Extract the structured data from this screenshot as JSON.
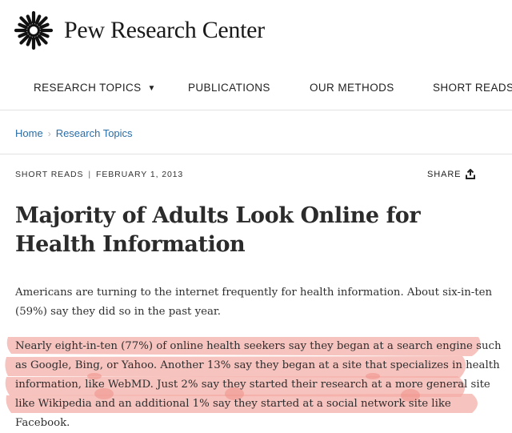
{
  "brand": {
    "name": "Pew Research Center",
    "logo_icon": "sunburst-logo-icon"
  },
  "nav": {
    "items": [
      {
        "label": "RESEARCH TOPICS",
        "has_dropdown": true
      },
      {
        "label": "PUBLICATIONS"
      },
      {
        "label": "OUR METHODS"
      },
      {
        "label": "SHORT READS"
      }
    ]
  },
  "breadcrumb": {
    "home": "Home",
    "current": "Research Topics"
  },
  "article": {
    "category": "SHORT READS",
    "date": "FEBRUARY 1, 2013",
    "share_label": "SHARE",
    "share_icon": "share-upload-icon",
    "title_line1": "Majority of Adults Look Online for",
    "title_line2": "Health Information",
    "paragraph1_line1": "Americans are turning to the internet frequently for health information. About six-in-ten",
    "paragraph1_line2": "(59%) say they did so in the past year.",
    "paragraph2_line1": "Nearly eight-in-ten (77%) of online health seekers say they began at a search engine such",
    "paragraph2_line2": "as Google, Bing, or Yahoo. Another 13% say they began at a site that specializes in health",
    "paragraph2_line3": "information, like WebMD. Just 2% say they started their research at a more general site",
    "paragraph2_line4": "like Wikipedia and an additional 1% say they started at a social network site like Facebook."
  },
  "colors": {
    "highlight": "#f4a9a2",
    "link": "#2a6ea8"
  }
}
